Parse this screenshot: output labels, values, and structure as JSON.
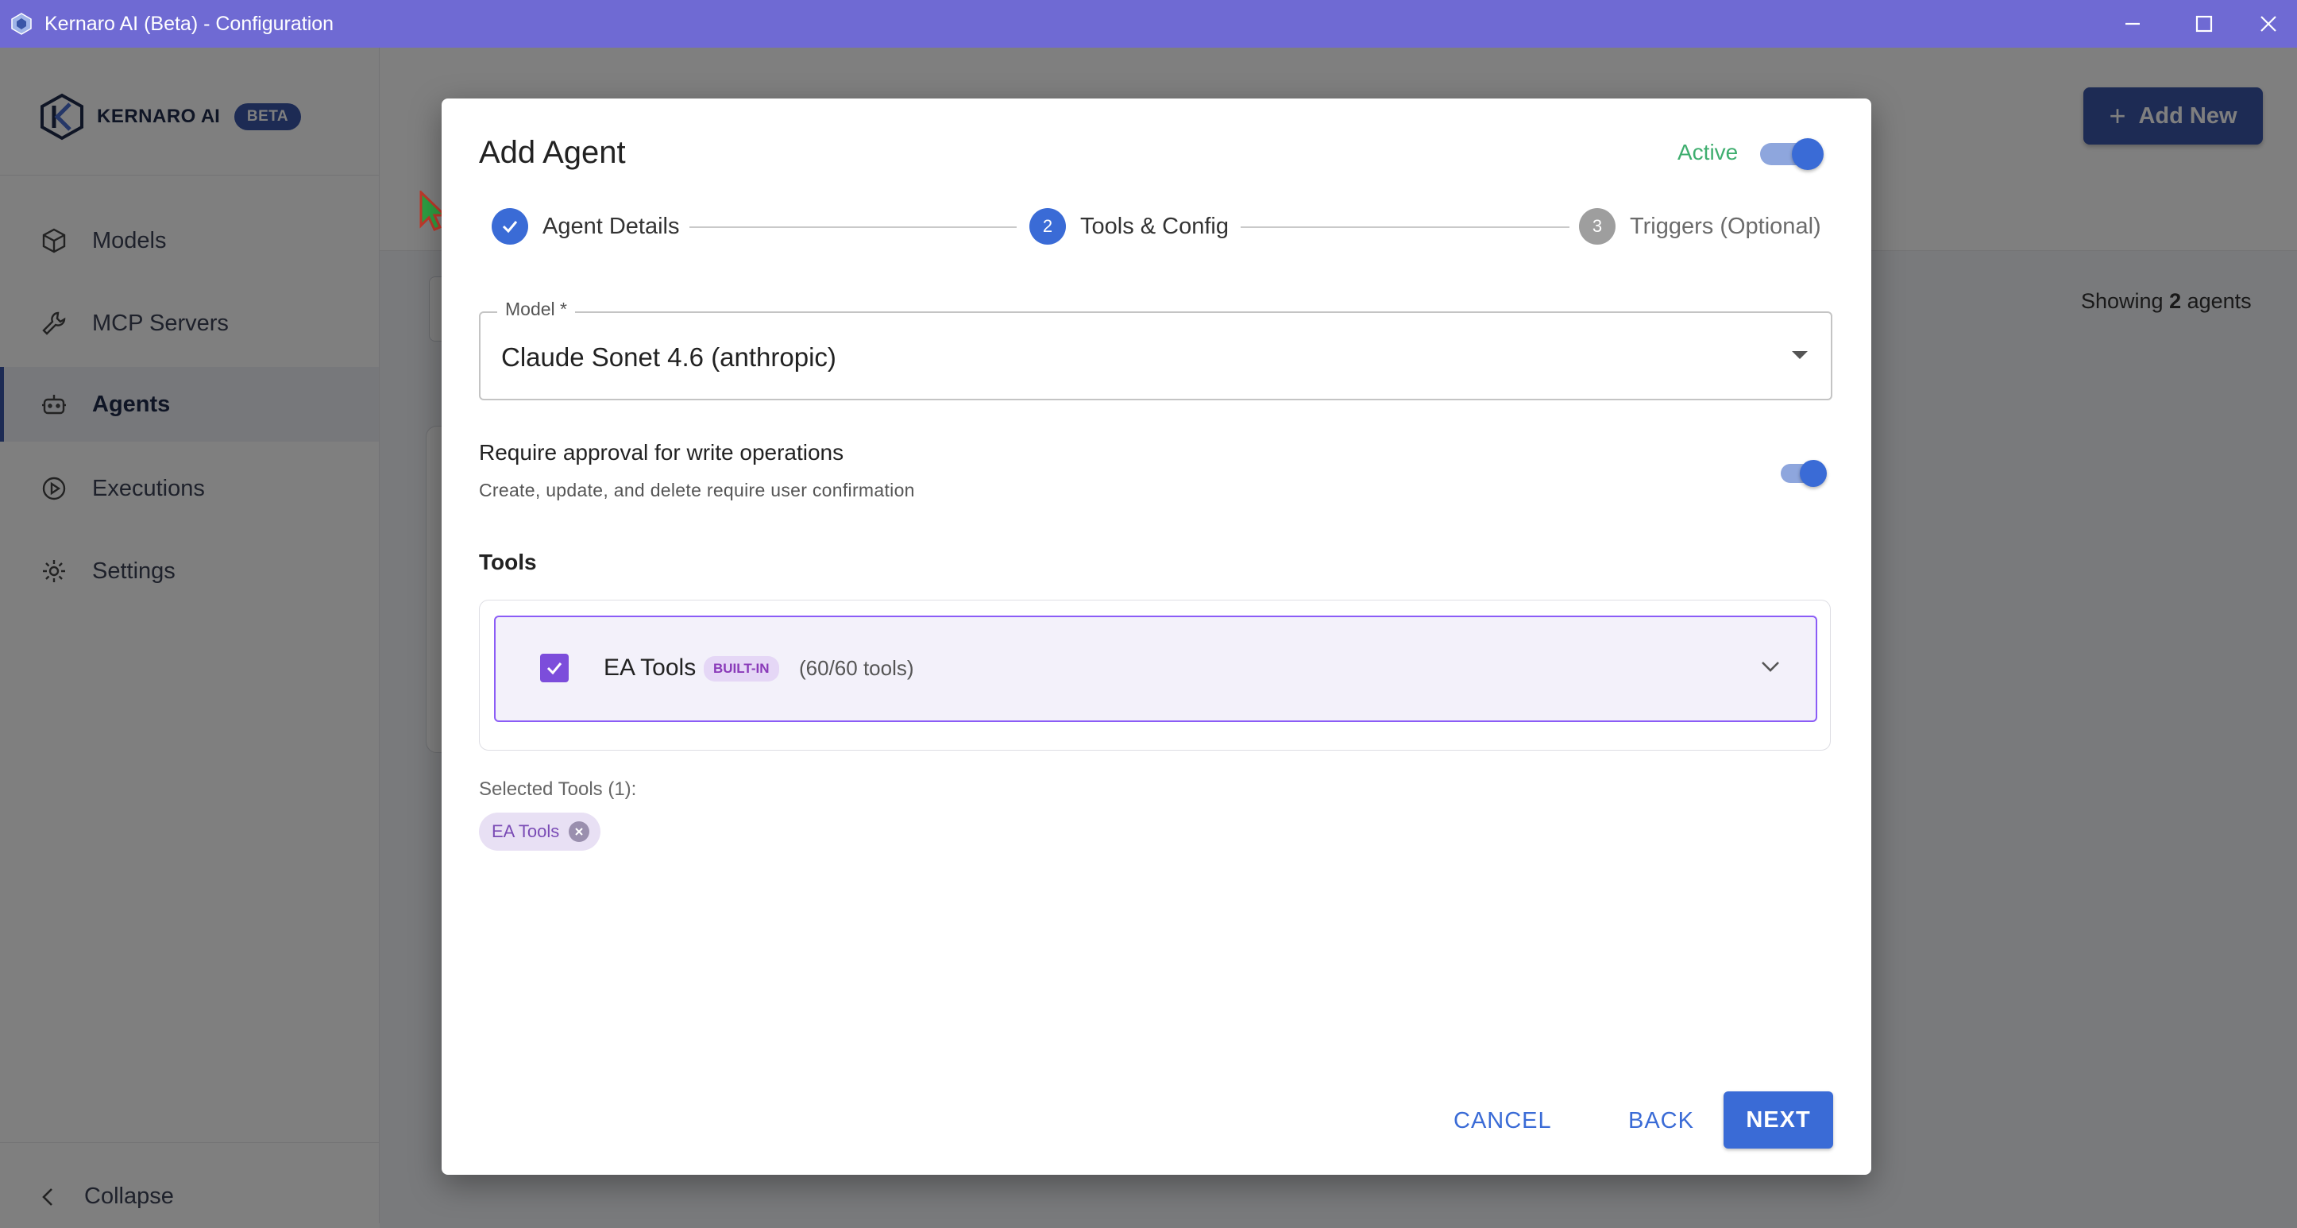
{
  "window": {
    "title": "Kernaro AI (Beta) - Configuration"
  },
  "sidebar": {
    "logo_text": "KERNARO",
    "logo_ai": "AI",
    "beta_badge": "BETA",
    "items": [
      {
        "label": "Models",
        "icon": "cube-icon"
      },
      {
        "label": "MCP Servers",
        "icon": "wrench-icon"
      },
      {
        "label": "Agents",
        "icon": "robot-icon",
        "active": true
      },
      {
        "label": "Executions",
        "icon": "play-circle-icon"
      },
      {
        "label": "Settings",
        "icon": "gear-icon"
      }
    ],
    "collapse_label": "Collapse"
  },
  "main": {
    "add_new_label": "Add New",
    "showing_prefix": "Showing ",
    "showing_count": "2",
    "showing_suffix": " agents"
  },
  "dialog": {
    "title": "Add Agent",
    "active_label": "Active",
    "active_on": true,
    "steps": [
      {
        "number": "1",
        "label": "Agent Details",
        "state": "done"
      },
      {
        "number": "2",
        "label": "Tools & Config",
        "state": "current"
      },
      {
        "number": "3",
        "label": "Triggers (Optional)",
        "state": "pending"
      }
    ],
    "model": {
      "label": "Model *",
      "value": "Claude Sonet 4.6 (anthropic)"
    },
    "approval": {
      "title": "Require approval for write operations",
      "description": "Create, update, and delete require user confirmation",
      "enabled": true
    },
    "tools_heading": "Tools",
    "tools": [
      {
        "name": "EA Tools",
        "badge": "BUILT-IN",
        "count": "(60/60 tools)",
        "checked": true
      }
    ],
    "selected_label": "Selected Tools (1):",
    "selected_chips": [
      "EA Tools"
    ],
    "buttons": {
      "cancel": "CANCEL",
      "back": "BACK",
      "next": "NEXT"
    }
  },
  "colors": {
    "titlebar": "#6f6ad3",
    "primary": "#3a6bd6",
    "brand": "#3a56a8",
    "tool_accent": "#8b5cf6",
    "active_green": "#3fae6f"
  }
}
